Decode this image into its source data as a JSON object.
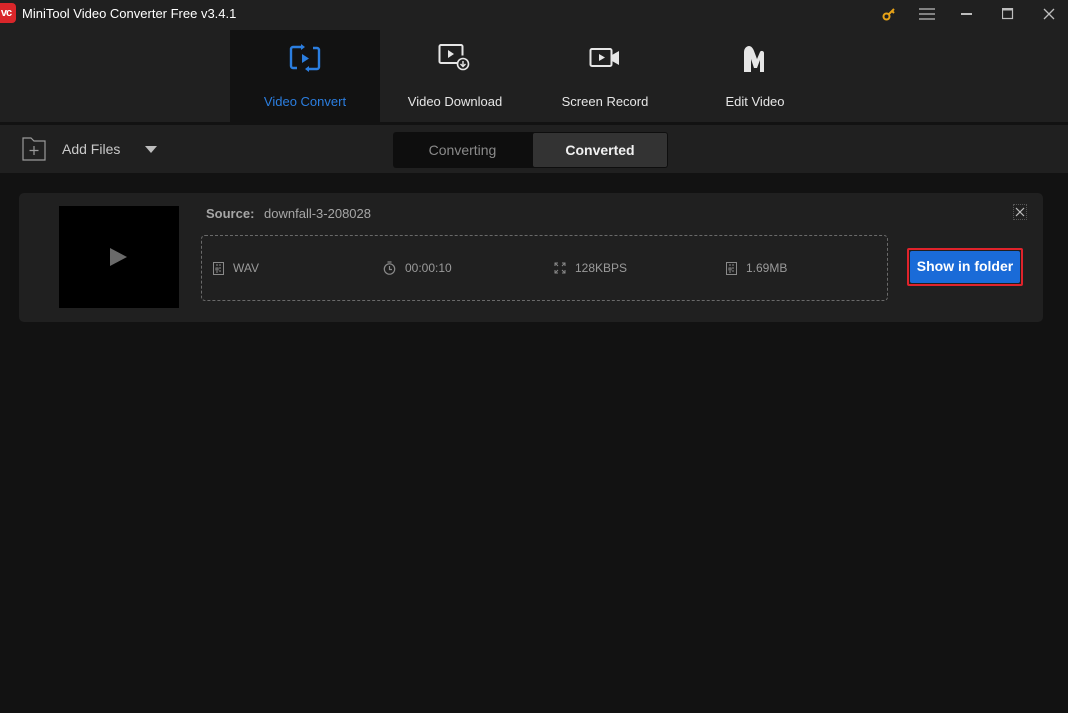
{
  "window": {
    "title": "MiniTool Video Converter Free v3.4.1",
    "logo_text": "vc",
    "controls": [
      "key-icon",
      "menu-icon",
      "minimize-icon",
      "maximize-icon",
      "close-icon"
    ]
  },
  "nav": {
    "items": [
      {
        "label": "Video Convert",
        "icon": "convert-icon",
        "active": true
      },
      {
        "label": "Video Download",
        "icon": "download-video-icon",
        "active": false
      },
      {
        "label": "Screen Record",
        "icon": "camera-icon",
        "active": false
      },
      {
        "label": "Edit Video",
        "icon": "movie-maker-icon",
        "active": false
      }
    ],
    "accent": "#2b7ee0"
  },
  "toolbar": {
    "add_files_label": "Add Files",
    "tabs": [
      {
        "label": "Converting",
        "active": false
      },
      {
        "label": "Converted",
        "active": true
      }
    ]
  },
  "file": {
    "source_label": "Source:",
    "source_name": "downfall-3-208028",
    "format": "WAV",
    "duration": "00:00:10",
    "bitrate": "128KBPS",
    "size": "1.69MB",
    "show_in_folder_label": "Show in folder"
  },
  "colors": {
    "button_blue": "#1a6bd8",
    "highlight_red": "#e0232b",
    "key_gold": "#e8a317"
  }
}
